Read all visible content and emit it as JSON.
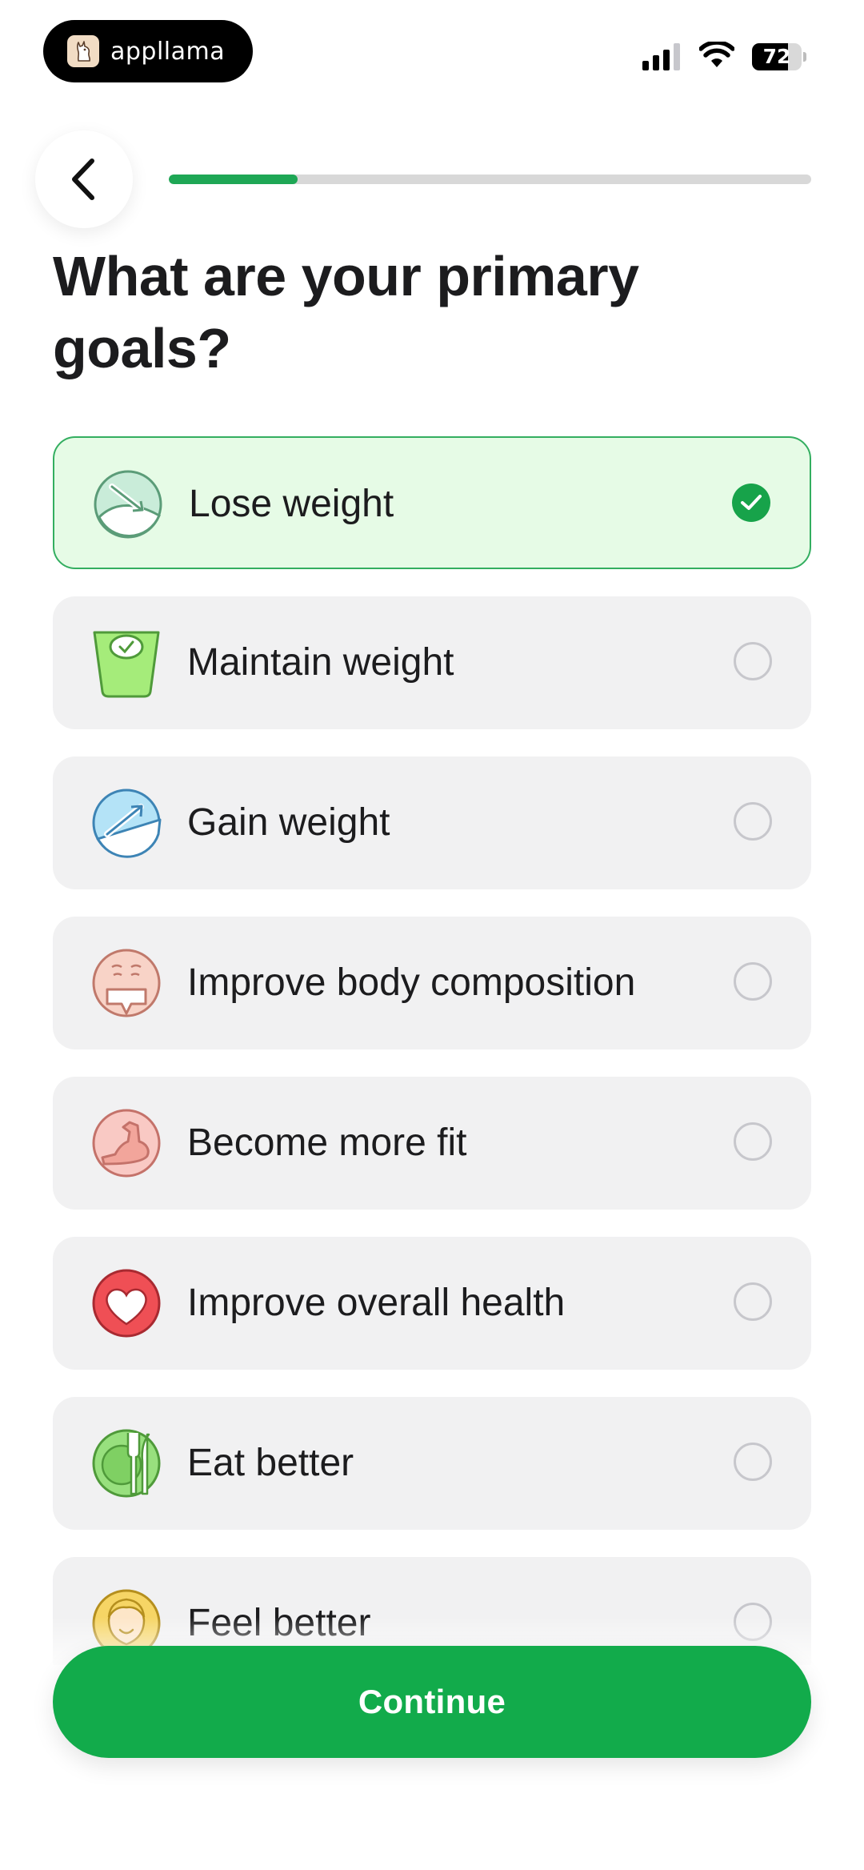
{
  "status_bar": {
    "app_badge": "appllama",
    "battery_level": "72",
    "signal_bars": 3,
    "signal_bars_total": 4
  },
  "header": {
    "back_icon": "chevron-left-icon",
    "progress_fraction": 0.2
  },
  "question": {
    "title": "What are your primary goals?"
  },
  "options": [
    {
      "label": "Lose weight",
      "icon": "weight-loss-icon",
      "selected": true
    },
    {
      "label": "Maintain weight",
      "icon": "scale-icon",
      "selected": false
    },
    {
      "label": "Gain weight",
      "icon": "weight-gain-icon",
      "selected": false
    },
    {
      "label": "Improve body composition",
      "icon": "torso-icon",
      "selected": false
    },
    {
      "label": "Become more fit",
      "icon": "flexed-bicep-icon",
      "selected": false
    },
    {
      "label": "Improve overall health",
      "icon": "heart-icon",
      "selected": false
    },
    {
      "label": "Eat better",
      "icon": "plate-cutlery-icon",
      "selected": false
    },
    {
      "label": "Feel better",
      "icon": "smiling-face-icon",
      "selected": false
    }
  ],
  "footer": {
    "continue_label": "Continue"
  },
  "colors": {
    "accent_green": "#12ab4b",
    "selected_bg": "#e6fbe6",
    "option_bg": "#f1f1f2"
  }
}
